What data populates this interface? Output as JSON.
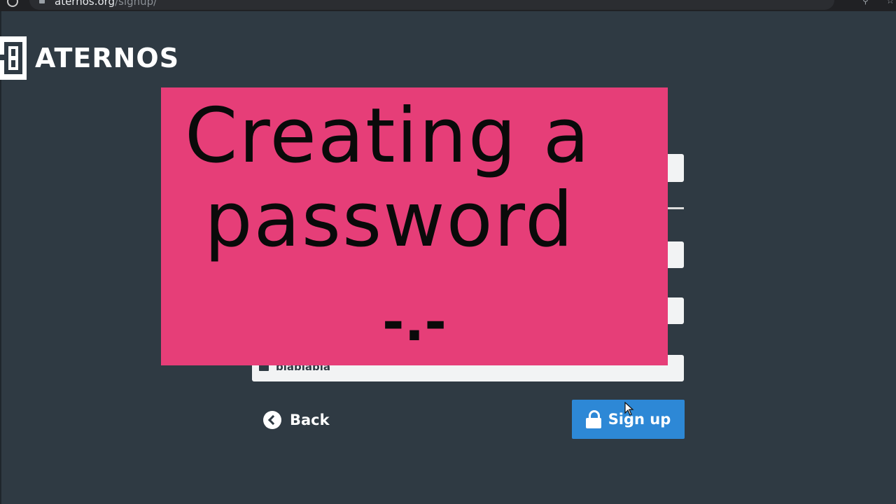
{
  "browser": {
    "url_domain": "aternos.org",
    "url_path": "/signup/"
  },
  "brand": {
    "logo_text": "ATERNOS"
  },
  "form": {
    "email_value": "blablabla"
  },
  "actions": {
    "back_label": "Back",
    "signup_label": "Sign up"
  },
  "overlay": {
    "line_1": "Creating a",
    "line_2": "password",
    "line_3": "-.-"
  },
  "colors": {
    "page_background": "#2f3a43",
    "overlay_background": "#e63e78",
    "primary_button": "#2d88d6",
    "field_background": "#f2f3f4"
  },
  "icons": {
    "reload": "reload-icon",
    "back": "chevron-left-circle-icon",
    "signup": "lock-icon",
    "email": "envelope-icon",
    "cursor": "mouse-pointer-icon"
  }
}
